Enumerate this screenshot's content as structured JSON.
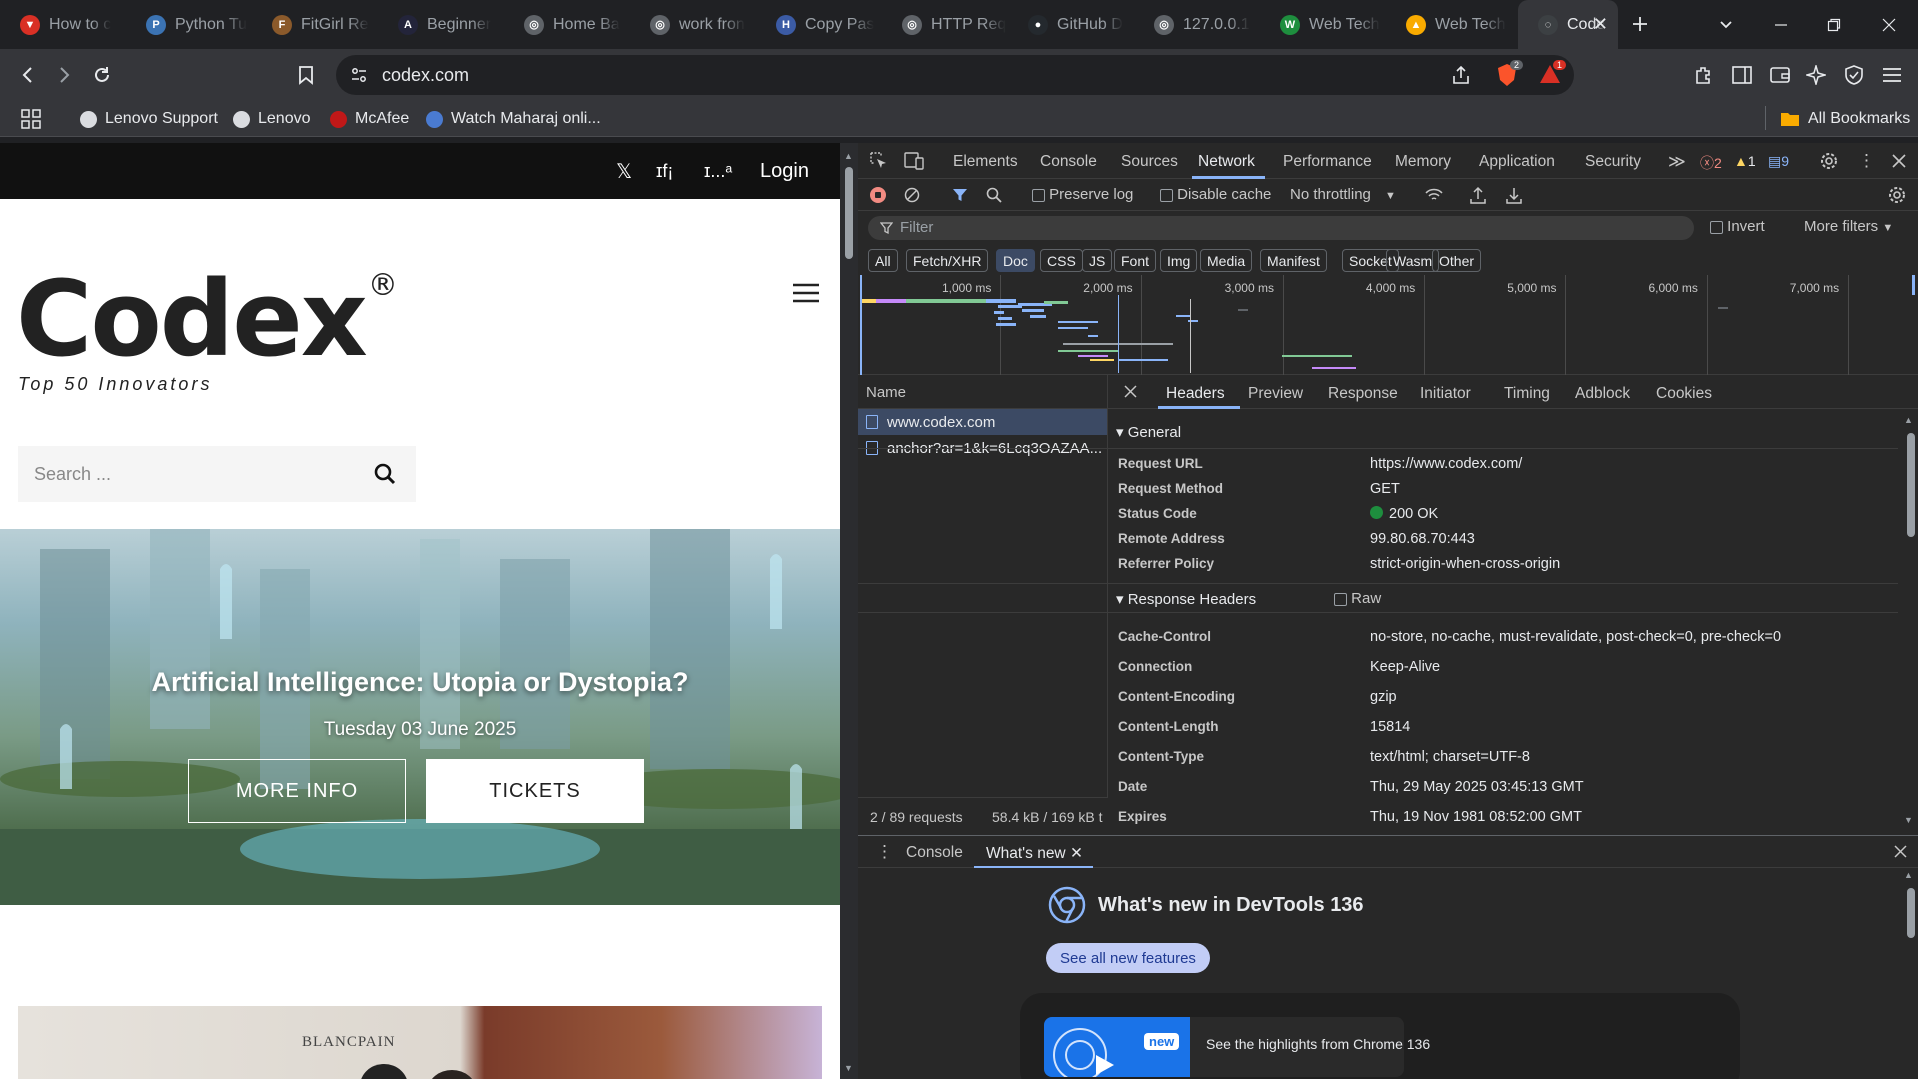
{
  "tabs": [
    {
      "title": "How to c",
      "color": "#d93025",
      "glyph": "▼"
    },
    {
      "title": "Python Tu",
      "color": "#3b73b3",
      "glyph": "P"
    },
    {
      "title": "FitGirl Re",
      "color": "#8b5a2b",
      "glyph": "F"
    },
    {
      "title": "Beginner",
      "color": "#23243a",
      "glyph": "A"
    },
    {
      "title": "Home Ba",
      "color": "#5f6368",
      "glyph": "◎"
    },
    {
      "title": "work fron",
      "color": "#5f6368",
      "glyph": "◎"
    },
    {
      "title": "Copy Pas",
      "color": "#3b5ba5",
      "glyph": "H"
    },
    {
      "title": "HTTP Req",
      "color": "#5f6368",
      "glyph": "◎"
    },
    {
      "title": "GitHub D",
      "color": "#24292e",
      "glyph": "●"
    },
    {
      "title": "127.0.0.1",
      "color": "#5f6368",
      "glyph": "◎"
    },
    {
      "title": "Web Tech",
      "color": "#1e8e3e",
      "glyph": "W"
    },
    {
      "title": "Web Tech",
      "color": "#f9ab00",
      "glyph": "▲"
    },
    {
      "title": "Code",
      "color": "#3c4043",
      "glyph": "◌",
      "active": true
    }
  ],
  "toolbar": {
    "url": "codex.com",
    "brave_badge": "2",
    "alert_badge": "1"
  },
  "bookmarks": [
    {
      "label": "Lenovo Support",
      "color": "#dadce0"
    },
    {
      "label": "Lenovo",
      "color": "#dadce0"
    },
    {
      "label": "McAfee",
      "color": "#c01818"
    },
    {
      "label": "Watch Maharaj onli...",
      "color": "#4a7bd1"
    }
  ],
  "all_bookmarks": "All Bookmarks",
  "site": {
    "top_icons": [
      "𝕏",
      "ɪf¡",
      "ɪ...ᵃ"
    ],
    "login": "Login",
    "logo": "Codex",
    "registered": "®",
    "tagline": "Top 50 Innovators",
    "search_placeholder": "Search ...",
    "hero_title": "Artificial Intelligence: Utopia or Dystopia?",
    "hero_date": "Tuesday 03 June 2025",
    "more_info": "MORE INFO",
    "tickets": "TICKETS",
    "photo_sign": "BLANCPAIN"
  },
  "devtools": {
    "tabs": [
      "Elements",
      "Console",
      "Sources",
      "Network",
      "Performance",
      "Memory",
      "Application",
      "Security"
    ],
    "active_tab": "Network",
    "errors": "2",
    "warnings": "1",
    "messages": "9",
    "preserve_log": "Preserve log",
    "disable_cache": "Disable cache",
    "throttling": "No throttling",
    "filter_placeholder": "Filter",
    "invert": "Invert",
    "more_filters": "More filters",
    "types": [
      "All",
      "Fetch/XHR",
      "Doc",
      "CSS",
      "JS",
      "Font",
      "Img",
      "Media",
      "Manifest",
      "Socket",
      "Wasm",
      "Other"
    ],
    "selected_type": "Doc",
    "timeline_ticks": [
      "1,000 ms",
      "2,000 ms",
      "3,000 ms",
      "4,000 ms",
      "5,000 ms",
      "6,000 ms",
      "7,000 ms"
    ],
    "name_header": "Name",
    "requests": [
      "www.codex.com",
      "anchor?ar=1&k=6Lcq3OAZAA..."
    ],
    "status_requests": "2 / 89 requests",
    "status_size": "58.4 kB / 169 kB t",
    "detail_tabs": [
      "Headers",
      "Preview",
      "Response",
      "Initiator",
      "Timing",
      "Adblock",
      "Cookies"
    ],
    "general_label": "General",
    "general": [
      {
        "k": "Request URL",
        "v": "https://www.codex.com/"
      },
      {
        "k": "Request Method",
        "v": "GET"
      },
      {
        "k": "Status Code",
        "v": "200 OK"
      },
      {
        "k": "Remote Address",
        "v": "99.80.68.70:443"
      },
      {
        "k": "Referrer Policy",
        "v": "strict-origin-when-cross-origin"
      }
    ],
    "response_headers_label": "Response Headers",
    "raw": "Raw",
    "response_headers": [
      {
        "k": "Cache-Control",
        "v": "no-store, no-cache, must-revalidate, post-check=0, pre-check=0"
      },
      {
        "k": "Connection",
        "v": "Keep-Alive"
      },
      {
        "k": "Content-Encoding",
        "v": "gzip"
      },
      {
        "k": "Content-Length",
        "v": "15814"
      },
      {
        "k": "Content-Type",
        "v": "text/html; charset=UTF-8"
      },
      {
        "k": "Date",
        "v": "Thu, 29 May 2025 03:45:13 GMT"
      },
      {
        "k": "Expires",
        "v": "Thu, 19 Nov 1981 08:52:00 GMT"
      }
    ],
    "drawer_tabs": [
      "Console",
      "What's new"
    ],
    "whats_new_title": "What's new in DevTools 136",
    "see_all": "See all new features",
    "new_badge": "new",
    "highlights": "See the highlights from Chrome 136"
  }
}
